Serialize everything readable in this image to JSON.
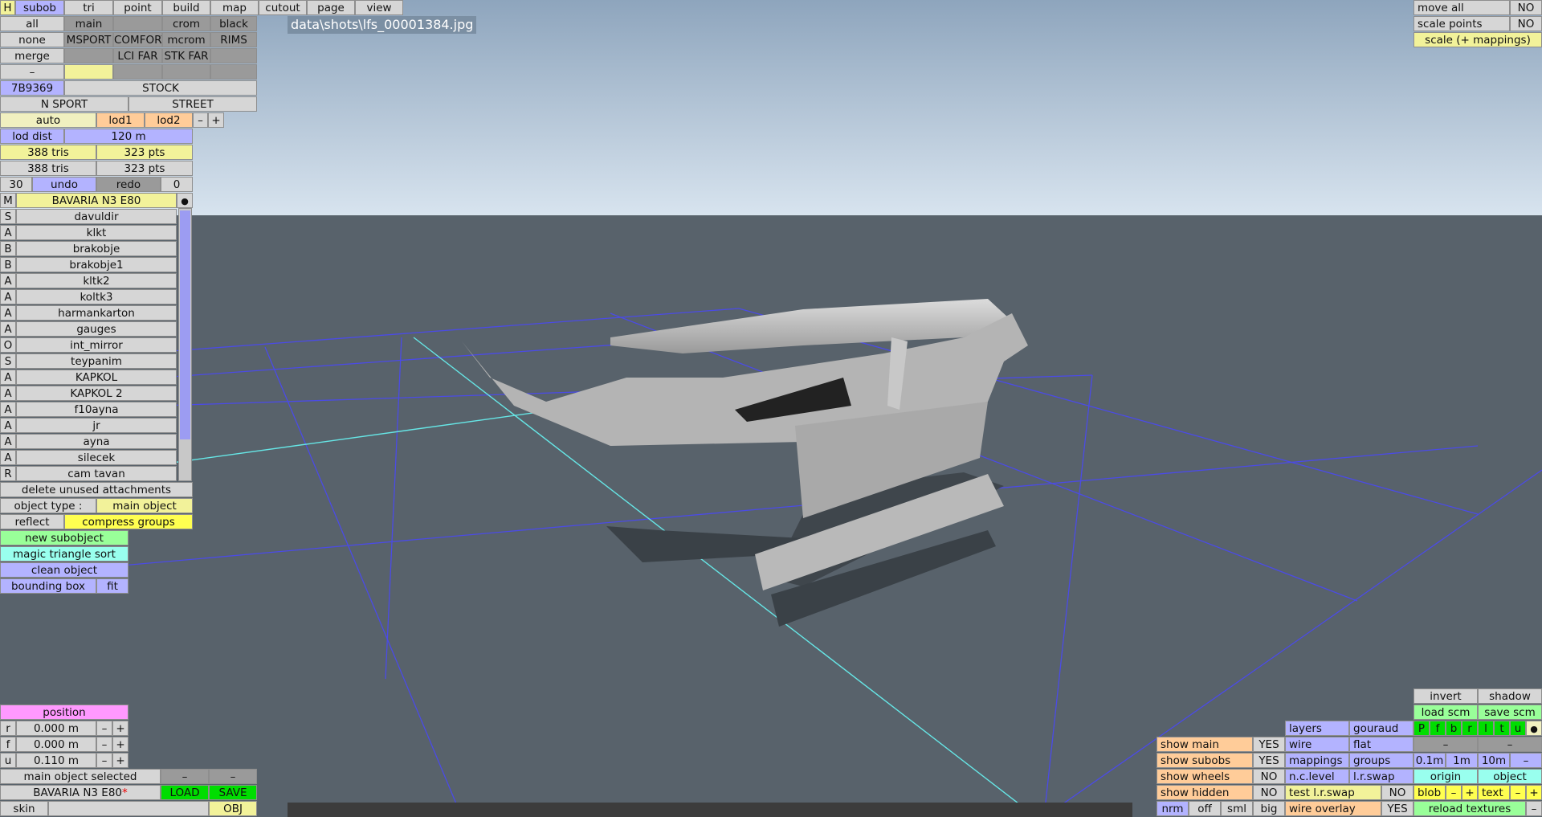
{
  "screenshot_label": "data\\shots\\lfs_00001384.jpg",
  "top_menu": {
    "h": "H",
    "subob": "subob",
    "tri": "tri",
    "point": "point",
    "build": "build",
    "map": "map",
    "cutout": "cutout",
    "page": "page",
    "view": "view"
  },
  "rows": {
    "all": "all",
    "main": "main",
    "crom": "crom",
    "black": "black",
    "none": "none",
    "msport": "MSPORT",
    "comfort": "COMFORT",
    "mcrom": "mcrom",
    "rims": "RIMS",
    "merge": "merge",
    "lci_far": "LCI FAR",
    "stk_far": "STK FAR",
    "dash": "–",
    "color_code": "7B9369",
    "stock": "STOCK",
    "n_sport": "N SPORT",
    "street": "STREET"
  },
  "lod": {
    "auto": "auto",
    "lod1": "lod1",
    "lod2": "lod2",
    "minus": "–",
    "plus": "+",
    "lod_dist_label": "lod dist",
    "lod_dist_value": "120 m",
    "tris1": "388 tris",
    "pts1": "323 pts",
    "tris2": "388 tris",
    "pts2": "323 pts"
  },
  "history": {
    "count": "30",
    "undo": "undo",
    "redo": "redo",
    "redo_count": "0"
  },
  "object_list": {
    "main_flag": "M",
    "main_name": "BAVARIA N3 E80",
    "dot": "●",
    "items": [
      {
        "flag": "S",
        "name": "davuldir"
      },
      {
        "flag": "A",
        "name": "klkt"
      },
      {
        "flag": "B",
        "name": "brakobje"
      },
      {
        "flag": "B",
        "name": "brakobje1"
      },
      {
        "flag": "A",
        "name": "kltk2"
      },
      {
        "flag": "A",
        "name": "koltk3"
      },
      {
        "flag": "A",
        "name": "harmankarton"
      },
      {
        "flag": "A",
        "name": "gauges"
      },
      {
        "flag": "O",
        "name": "int_mirror"
      },
      {
        "flag": "S",
        "name": "teypanim"
      },
      {
        "flag": "A",
        "name": "KAPKOL"
      },
      {
        "flag": "A",
        "name": "KAPKOL 2"
      },
      {
        "flag": "A",
        "name": "f10ayna"
      },
      {
        "flag": "A",
        "name": "jr"
      },
      {
        "flag": "A",
        "name": "ayna"
      },
      {
        "flag": "A",
        "name": "silecek"
      },
      {
        "flag": "R",
        "name": "cam tavan"
      }
    ]
  },
  "object_panel": {
    "delete_unused": "delete unused attachments",
    "object_type_label": "object type :",
    "object_type_value": "main object",
    "reflect": "reflect",
    "compress_groups": "compress groups",
    "new_subobject": "new subobject",
    "magic_sort": "magic triangle sort",
    "clean_object": "clean object",
    "bounding_box": "bounding box",
    "fit": "fit"
  },
  "position": {
    "title": "position",
    "r_label": "r",
    "r_value": "0.000 m",
    "f_label": "f",
    "f_value": "0.000 m",
    "u_label": "u",
    "u_value": "0.110 m",
    "minus": "–",
    "plus": "+"
  },
  "bottom_left": {
    "selected": "main object selected",
    "minus": "–",
    "file_name": "BAVARIA N3 E80",
    "modified_mark": "*",
    "load": "LOAD",
    "save": "SAVE",
    "skin": "skin",
    "obj": "OBJ"
  },
  "top_right": {
    "move_all": "move all",
    "move_all_value": "NO",
    "scale_points": "scale points",
    "scale_points_value": "NO",
    "scale_mappings": "scale (+ mappings)"
  },
  "bottom_right": {
    "invert": "invert",
    "shadow": "shadow",
    "load_scm": "load scm",
    "save_scm": "save scm",
    "layers": "layers",
    "gouraud": "gouraud",
    "letters": [
      "P",
      "f",
      "b",
      "r",
      "l",
      "t",
      "u"
    ],
    "dot": "●",
    "show_main": "show main",
    "show_main_v": "YES",
    "wire": "wire",
    "flat": "flat",
    "dash": "–",
    "show_subobs": "show subobs",
    "show_subobs_v": "YES",
    "mappings": "mappings",
    "groups": "groups",
    "g01": "0.1m",
    "g1": "1m",
    "g10": "10m",
    "show_wheels": "show wheels",
    "show_wheels_v": "NO",
    "nc_level": "n.c.level",
    "lr_swap": "l.r.swap",
    "origin": "origin",
    "object": "object",
    "show_hidden": "show hidden",
    "show_hidden_v": "NO",
    "test_lr_swap": "test l.r.swap",
    "test_lr_swap_v": "NO",
    "blob": "blob",
    "plus": "+",
    "text": "text",
    "nrm": "nrm",
    "off": "off",
    "sml": "sml",
    "big": "big",
    "wire_overlay": "wire overlay",
    "wire_overlay_v": "YES",
    "reload_textures": "reload textures"
  },
  "colors": {
    "sky_top": "#8fa6be",
    "sky_bottom": "#d6e2ee",
    "ground": "#58626b",
    "grid": "#4b4be6",
    "axis": "#66e6e6",
    "panel_grey": "#d6d6d6",
    "panel_blue": "#b3b3ff",
    "panel_yellow": "#f2f29a",
    "panel_orange": "#ffcc99"
  }
}
